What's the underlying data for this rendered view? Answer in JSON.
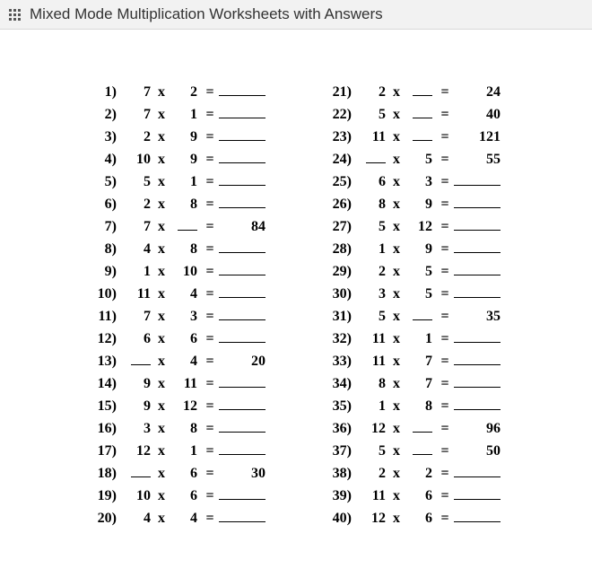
{
  "title": "Mixed Mode Multiplication Worksheets with Answers",
  "symbols": {
    "times": "x",
    "equals": "="
  },
  "problems": [
    {
      "n": "1)",
      "a": "7",
      "b": "2",
      "ans": null
    },
    {
      "n": "2)",
      "a": "7",
      "b": "1",
      "ans": null
    },
    {
      "n": "3)",
      "a": "2",
      "b": "9",
      "ans": null
    },
    {
      "n": "4)",
      "a": "10",
      "b": "9",
      "ans": null
    },
    {
      "n": "5)",
      "a": "5",
      "b": "1",
      "ans": null
    },
    {
      "n": "6)",
      "a": "2",
      "b": "8",
      "ans": null
    },
    {
      "n": "7)",
      "a": "7",
      "b": null,
      "ans": "84"
    },
    {
      "n": "8)",
      "a": "4",
      "b": "8",
      "ans": null
    },
    {
      "n": "9)",
      "a": "1",
      "b": "10",
      "ans": null
    },
    {
      "n": "10)",
      "a": "11",
      "b": "4",
      "ans": null
    },
    {
      "n": "11)",
      "a": "7",
      "b": "3",
      "ans": null
    },
    {
      "n": "12)",
      "a": "6",
      "b": "6",
      "ans": null
    },
    {
      "n": "13)",
      "a": null,
      "b": "4",
      "ans": "20"
    },
    {
      "n": "14)",
      "a": "9",
      "b": "11",
      "ans": null
    },
    {
      "n": "15)",
      "a": "9",
      "b": "12",
      "ans": null
    },
    {
      "n": "16)",
      "a": "3",
      "b": "8",
      "ans": null
    },
    {
      "n": "17)",
      "a": "12",
      "b": "1",
      "ans": null
    },
    {
      "n": "18)",
      "a": null,
      "b": "6",
      "ans": "30"
    },
    {
      "n": "19)",
      "a": "10",
      "b": "6",
      "ans": null
    },
    {
      "n": "20)",
      "a": "4",
      "b": "4",
      "ans": null
    },
    {
      "n": "21)",
      "a": "2",
      "b": null,
      "ans": "24"
    },
    {
      "n": "22)",
      "a": "5",
      "b": null,
      "ans": "40"
    },
    {
      "n": "23)",
      "a": "11",
      "b": null,
      "ans": "121"
    },
    {
      "n": "24)",
      "a": null,
      "b": "5",
      "ans": "55"
    },
    {
      "n": "25)",
      "a": "6",
      "b": "3",
      "ans": null
    },
    {
      "n": "26)",
      "a": "8",
      "b": "9",
      "ans": null
    },
    {
      "n": "27)",
      "a": "5",
      "b": "12",
      "ans": null
    },
    {
      "n": "28)",
      "a": "1",
      "b": "9",
      "ans": null
    },
    {
      "n": "29)",
      "a": "2",
      "b": "5",
      "ans": null
    },
    {
      "n": "30)",
      "a": "3",
      "b": "5",
      "ans": null
    },
    {
      "n": "31)",
      "a": "5",
      "b": null,
      "ans": "35"
    },
    {
      "n": "32)",
      "a": "11",
      "b": "1",
      "ans": null
    },
    {
      "n": "33)",
      "a": "11",
      "b": "7",
      "ans": null
    },
    {
      "n": "34)",
      "a": "8",
      "b": "7",
      "ans": null
    },
    {
      "n": "35)",
      "a": "1",
      "b": "8",
      "ans": null
    },
    {
      "n": "36)",
      "a": "12",
      "b": null,
      "ans": "96"
    },
    {
      "n": "37)",
      "a": "5",
      "b": null,
      "ans": "50"
    },
    {
      "n": "38)",
      "a": "2",
      "b": "2",
      "ans": null
    },
    {
      "n": "39)",
      "a": "11",
      "b": "6",
      "ans": null
    },
    {
      "n": "40)",
      "a": "12",
      "b": "6",
      "ans": null
    }
  ]
}
